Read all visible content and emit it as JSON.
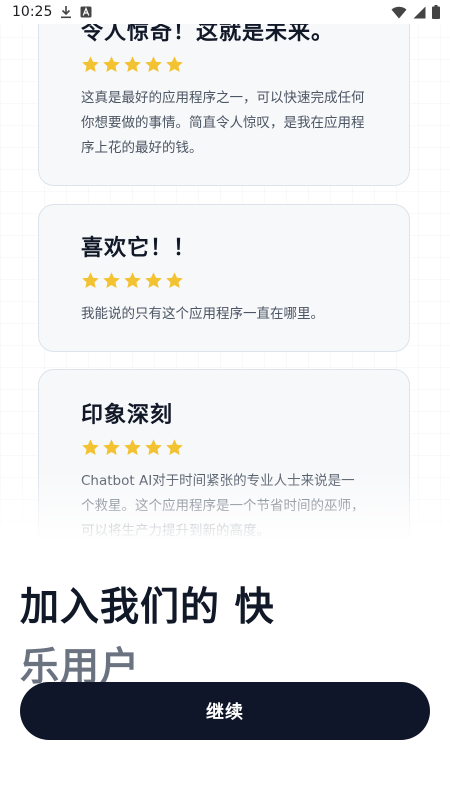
{
  "status_bar": {
    "time": "10:25",
    "icons": [
      "download-icon",
      "a-notification-icon",
      "wifi-icon",
      "signal-icon",
      "battery-icon"
    ]
  },
  "reviews": [
    {
      "title": "令人惊奇！这就是未来。",
      "rating": 5,
      "text": "这真是最好的应用程序之一，可以快速完成任何你想要做的事情。简直令人惊叹，是我在应用程序上花的最好的钱。"
    },
    {
      "title": "喜欢它！！",
      "rating": 5,
      "text": "我能说的只有这个应用程序一直在哪里。"
    },
    {
      "title": "印象深刻",
      "rating": 5,
      "text": "Chatbot AI对于时间紧张的专业人士来说是一个救星。这个应用程序是一个节省时间的巫师，可以将生产力提升到新的高度。"
    }
  ],
  "headline": {
    "line1": "加入我们的 快",
    "line2": "乐用户"
  },
  "continue_label": "继续",
  "colors": {
    "star": "#f2c230",
    "button_bg": "#0f1629",
    "card_bg": "#f7f8fa"
  }
}
